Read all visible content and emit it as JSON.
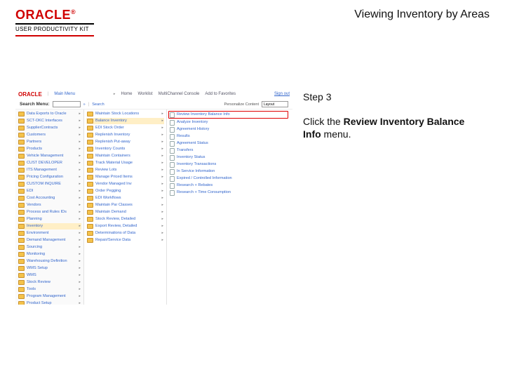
{
  "header": {
    "oracle": "ORACLE",
    "reg": "®",
    "upk": "USER PRODUCTIVITY KIT",
    "title": "Viewing Inventory by Areas"
  },
  "shot": {
    "top": {
      "oracle": "ORACLE",
      "mainMenu": "Main Menu",
      "home": "Home",
      "worklist": "Worklist",
      "mcc": "MultiChannel Console",
      "atf": "Add to Favorites",
      "signout": "Sign out"
    },
    "search": {
      "label": "Search Menu:",
      "go": "»",
      "searchLink": "Search",
      "pcLabel": "Personalize Content",
      "pcSel": "Layout"
    },
    "col1": [
      "Data Exports to Oracle",
      "SCT-OKC Interfaces",
      "SupplierContracts",
      "Customers",
      "Partners",
      "Products",
      "Vehicle Management",
      "CUST DEVELOPER",
      "ITS Management",
      "Pricing Configuration",
      "CUSTOM INQUIRE",
      "EDI",
      "Cost Accounting",
      "Vendors",
      "Process and Rules IDs",
      "Planning",
      "Inventory",
      "Environment",
      "Demand Management",
      "Sourcing",
      "Monitoring",
      "Warehousing Definition",
      "WMS Setup",
      "WMS",
      "Stock Review",
      "Tools",
      "Program Management",
      "Product Setup"
    ],
    "col1_selectedIndex": 16,
    "col2": [
      "Maintain Stock Locations",
      "Balance Inventory",
      "EDI Stock Order",
      "Replenish Inventory",
      "Replenish Put-away",
      "Inventory Counts",
      "Maintain Containers",
      "Track Material Usage",
      "Review Lots",
      "Manage Priced Items",
      "Vendor Managed Inv",
      "Order Pegging",
      "EDI Workflows",
      "Maintain Par Classes",
      "Maintain Demand",
      "Stock Review, Detailed",
      "Export Review, Detailed",
      "Determinations of Data",
      "Repair/Service Data"
    ],
    "col2_selectedIndex": 1,
    "col3_highlight": "Review Inventory Balance Info",
    "col3": [
      "Analyze Inventory",
      "Agreement History",
      "Results",
      "Agreement Status",
      "Transfers",
      "Inventory Status",
      "Inventory Transactions",
      "In Service Information",
      "Expired / Controlled Information",
      "Research + Rebates",
      "Research + Time Consumption"
    ]
  },
  "instr": {
    "step": "Step 3",
    "pre": "Click the ",
    "bold": "Review Inventory Balance Info",
    "post": " menu."
  }
}
